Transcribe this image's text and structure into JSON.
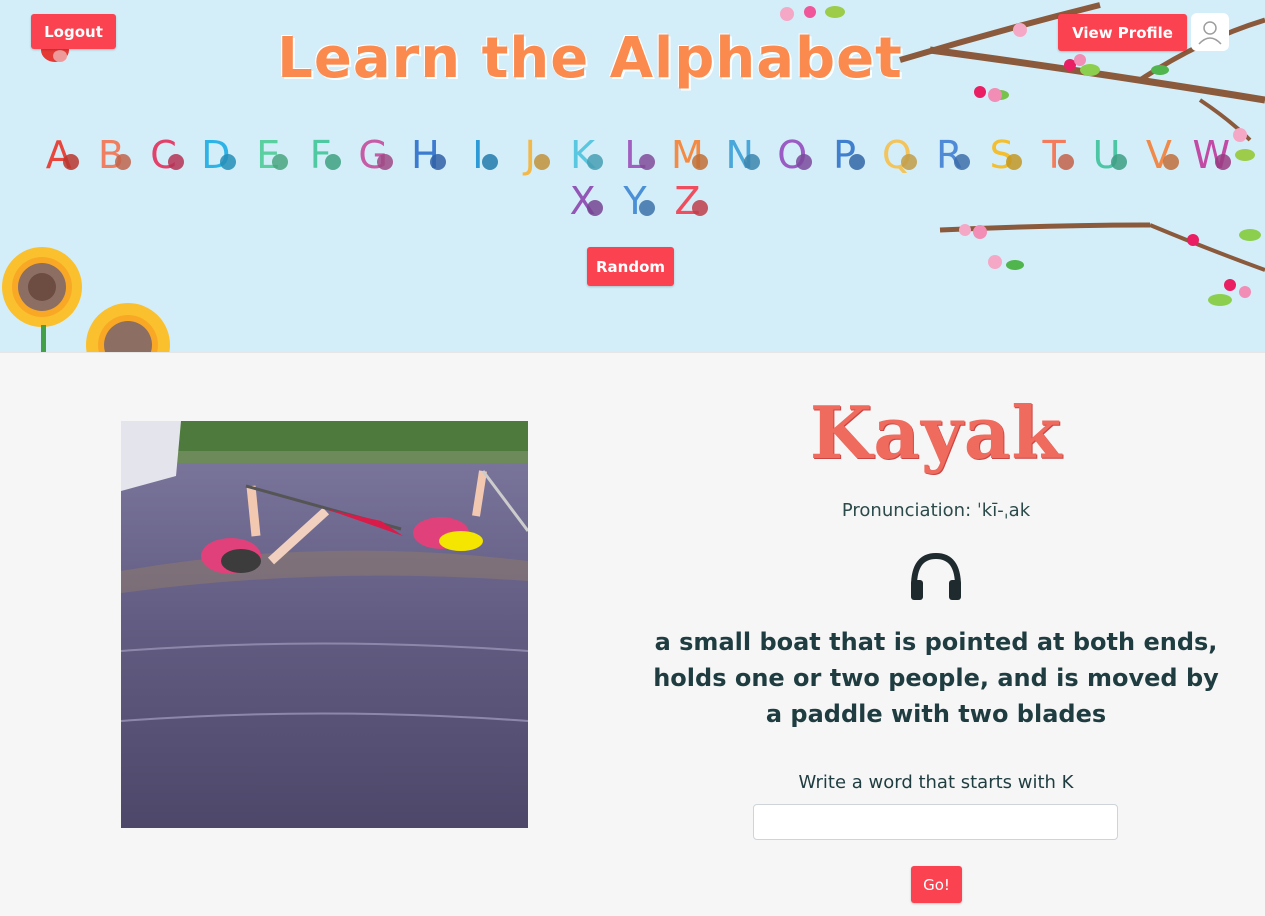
{
  "header": {
    "title": "Learn the Alphabet",
    "logout_label": "Logout",
    "profile_label": "View Profile",
    "random_label": "Random"
  },
  "letters": [
    {
      "char": "A",
      "color": "#e8453c"
    },
    {
      "char": "B",
      "color": "#f07f62"
    },
    {
      "char": "C",
      "color": "#e2416a"
    },
    {
      "char": "D",
      "color": "#2eb3e6"
    },
    {
      "char": "E",
      "color": "#5bcf9f"
    },
    {
      "char": "F",
      "color": "#4ec9a2"
    },
    {
      "char": "G",
      "color": "#c75ca6"
    },
    {
      "char": "H",
      "color": "#3d7bd1"
    },
    {
      "char": "I",
      "color": "#2b9ad7"
    },
    {
      "char": "J",
      "color": "#f2b84a"
    },
    {
      "char": "K",
      "color": "#5ac7e0"
    },
    {
      "char": "L",
      "color": "#a15fc0"
    },
    {
      "char": "M",
      "color": "#f38b45"
    },
    {
      "char": "N",
      "color": "#4aa7d9"
    },
    {
      "char": "O",
      "color": "#9a5cc4"
    },
    {
      "char": "P",
      "color": "#3f7fce"
    },
    {
      "char": "Q",
      "color": "#f2c45b"
    },
    {
      "char": "R",
      "color": "#4e8ad6"
    },
    {
      "char": "S",
      "color": "#f3be2f"
    },
    {
      "char": "T",
      "color": "#f47c5c"
    },
    {
      "char": "U",
      "color": "#4cc7a5"
    },
    {
      "char": "V",
      "color": "#f08a4a"
    },
    {
      "char": "W",
      "color": "#c24aa4"
    },
    {
      "char": "X",
      "color": "#9356b6"
    },
    {
      "char": "Y",
      "color": "#4b8fd6"
    },
    {
      "char": "Z",
      "color": "#f04e5e"
    }
  ],
  "main": {
    "word": "Kayak",
    "pronunciation": "Pronunciation: ˈkī-ˌak",
    "definition": "a small boat that is pointed at both ends, holds one or two people, and is moved by a paddle with two blades",
    "prompt": "Write a word that starts with K",
    "answer_value": "",
    "go_label": "Go!"
  },
  "icons": {
    "audio": "headphones-icon",
    "avatar": "user-icon"
  }
}
